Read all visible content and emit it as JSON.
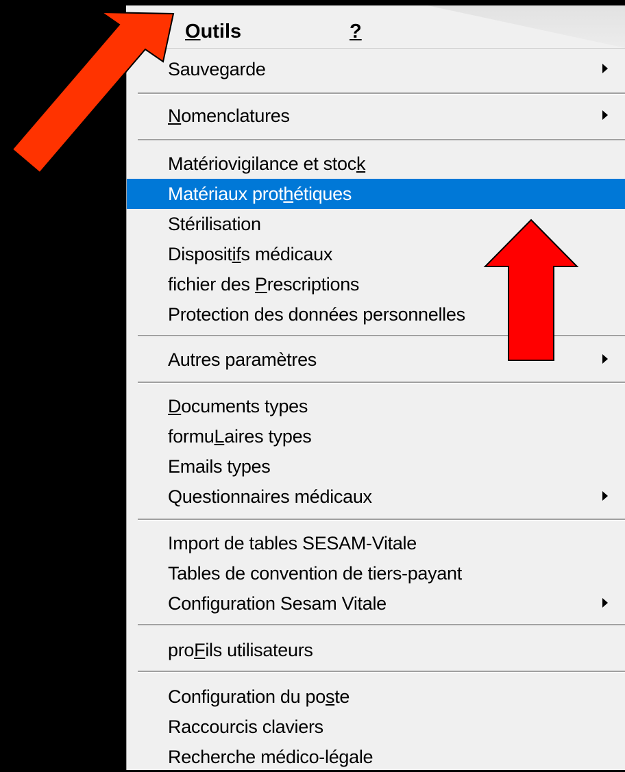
{
  "menubar": {
    "items": [
      {
        "pre": "",
        "mn": "O",
        "post": "utils"
      },
      {
        "pre": "",
        "mn": "?",
        "post": ""
      }
    ]
  },
  "menu": {
    "items": [
      {
        "pre": "Sauve",
        "mn": "g",
        "post": "arde",
        "submenu": true
      },
      {
        "pre": "",
        "mn": "N",
        "post": "omenclatures",
        "submenu": true
      },
      {
        "pre": "Matériovigilance et stoc",
        "mn": "k",
        "post": "",
        "submenu": false
      },
      {
        "pre": "Matériaux prot",
        "mn": "h",
        "post": "étiques",
        "submenu": false,
        "highlighted": true
      },
      {
        "pre": "Stérilisation",
        "mn": "",
        "post": "",
        "submenu": false
      },
      {
        "pre": "Disposit",
        "mn": "if",
        "post": "s médicaux",
        "submenu": false
      },
      {
        "pre": "fichier des ",
        "mn": "P",
        "post": "rescriptions",
        "submenu": false
      },
      {
        "pre": "Protection des données personnelles",
        "mn": "",
        "post": "",
        "submenu": false
      },
      {
        "pre": "Autres paramètres",
        "mn": "",
        "post": "",
        "submenu": true
      },
      {
        "pre": "",
        "mn": "D",
        "post": "ocuments types",
        "submenu": false
      },
      {
        "pre": "formu",
        "mn": "L",
        "post": "aires types",
        "submenu": false
      },
      {
        "pre": "Emails types",
        "mn": "",
        "post": "",
        "submenu": false
      },
      {
        "pre": "Questionnaires médicaux",
        "mn": "",
        "post": "",
        "submenu": true
      },
      {
        "pre": "Import de tables SESAM-Vitale",
        "mn": "",
        "post": "",
        "submenu": false
      },
      {
        "pre": "Tables de convention de tiers-payant",
        "mn": "",
        "post": "",
        "submenu": false
      },
      {
        "pre": "Configuration Sesam Vitale",
        "mn": "",
        "post": "",
        "submenu": true
      },
      {
        "pre": "pro",
        "mn": "F",
        "post": "ils utilisateurs",
        "submenu": false
      },
      {
        "pre": "Configuration du po",
        "mn": "s",
        "post": "te",
        "submenu": false
      },
      {
        "pre": "Raccourcis claviers",
        "mn": "",
        "post": "",
        "submenu": false
      },
      {
        "pre": "Recherche médico-légale",
        "mn": "",
        "post": "",
        "submenu": false
      }
    ]
  },
  "colors": {
    "highlight": "#0078d7",
    "menu_bg": "#f0f0f0",
    "arrow_fill": "#ff0000",
    "arrow_orange": "#ff3300"
  }
}
